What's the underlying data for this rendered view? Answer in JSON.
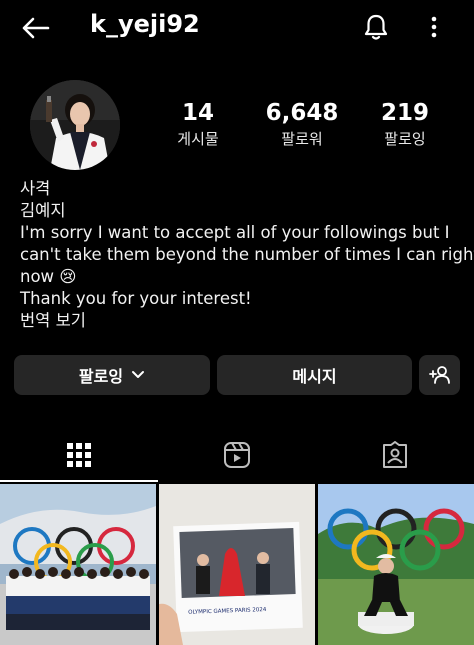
{
  "header": {
    "username": "k_yeji92",
    "back_icon": "arrow-left-icon",
    "bell_icon": "bell-icon",
    "more_icon": "more-vertical-icon"
  },
  "profile": {
    "stats": [
      {
        "value": "14",
        "label": "게시물"
      },
      {
        "value": "6,648",
        "label": "팔로워"
      },
      {
        "value": "219",
        "label": "팔로잉"
      }
    ]
  },
  "bio": {
    "category": "사격",
    "name": "김예지",
    "lines": [
      "I'm sorry I want to accept all of your followings but I",
      "can't take them beyond the number of times I can right",
      "now 😢",
      "Thank you for your interest!"
    ],
    "translate_link": "번역 보기"
  },
  "actions": {
    "following_label": "팔로잉",
    "message_label": "메시지",
    "suggest_icon": "add-person-icon"
  },
  "tabs": [
    {
      "name": "grid",
      "icon": "grid-icon",
      "active": true
    },
    {
      "name": "reels",
      "icon": "reels-icon",
      "active": false
    },
    {
      "name": "tagged",
      "icon": "tagged-person-icon",
      "active": false
    }
  ],
  "posts": {
    "caption_sign": "OLYMPIC GAMES PARIS 2024"
  },
  "colors": {
    "background": "#000000",
    "button": "#262626",
    "text": "#f5f5f5"
  }
}
